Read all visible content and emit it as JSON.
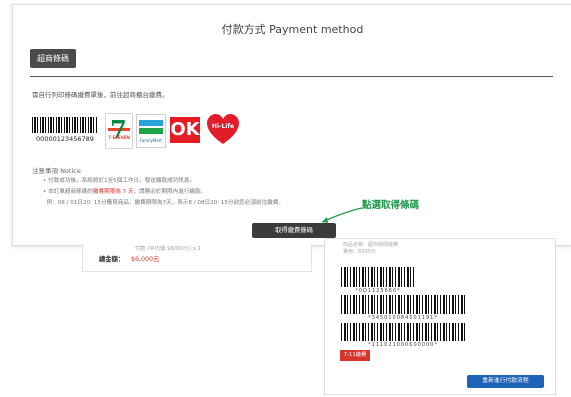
{
  "header": {
    "title": "付款方式 Payment method"
  },
  "tab": {
    "label": "超商條碼"
  },
  "intro": "需自行列印條碼繳費單後，前往超商櫃台繳費。",
  "sample_barcode_number": "00000123456789",
  "logos": {
    "seven_eleven": "7-ELEVEN",
    "familymart": "FamilyMart",
    "ok": "OK",
    "hilife": "Hi-Life"
  },
  "notice": {
    "heading": "注意事項 Notice",
    "items": [
      "付款成功後，系統將於1至5個工作日，發送繳款成功訊息。",
      {
        "prefix": "本訂單超商條碼的",
        "highlight": "繳費期限為 7 天",
        "suffix": "，請務必於期限內進行繳款。"
      },
      "例：08 / 01日20: 15分購買商品，繳費期限為7天，表示8 / 08日20: 15分前您必須前往繳費。"
    ]
  },
  "get_barcode_button": "取得繳費條碼",
  "callout_label": "點選取得條碼",
  "order": {
    "line_item": "付款 (平均價 $6000元) x 1",
    "total_label": "總金額：",
    "total_value": "$6,000元"
  },
  "barcode_sheet": {
    "line1": "商品名稱：超商條碼繳費",
    "line2": "費用：6000元",
    "codes": [
      "*0D1125660*",
      "*345010084501191*",
      "*111021000600000*"
    ],
    "store_badge": "7-11繳費",
    "update_button": "重新進行付款流程"
  },
  "colors": {
    "accent_green": "#1f9a4c",
    "warning_red": "#d9342b",
    "primary_blue": "#1f63b9",
    "dark_button": "#3b3b3b"
  }
}
